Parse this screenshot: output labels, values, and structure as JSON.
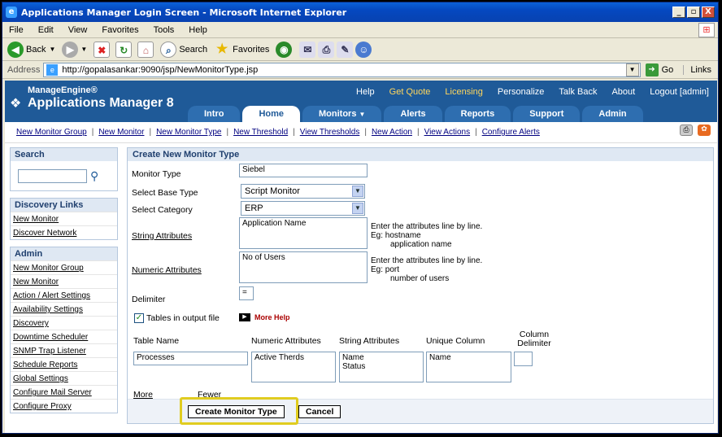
{
  "window": {
    "title": "Applications Manager Login Screen - Microsoft Internet Explorer",
    "btn_min": "_",
    "btn_max": "ฅ",
    "btn_close": "X"
  },
  "menu": [
    "File",
    "Edit",
    "View",
    "Favorites",
    "Tools",
    "Help"
  ],
  "toolbar": {
    "back": "Back",
    "search": "Search",
    "favorites": "Favorites"
  },
  "address": {
    "label": "Address",
    "url": "http://gopalasankar:9090/jsp/NewMonitorType.jsp",
    "go": "Go",
    "links": "Links"
  },
  "app": {
    "logo_top": "ManageEngine®",
    "logo_main": "Applications Manager 8",
    "top_links": [
      "Help",
      "Get Quote",
      "Licensing",
      "Personalize",
      "Talk Back",
      "About",
      "Logout  [admin]"
    ],
    "tabs": [
      "Intro",
      "Home",
      "Monitors",
      "Alerts",
      "Reports",
      "Support",
      "Admin"
    ]
  },
  "subnav": [
    "New Monitor Group",
    "New Monitor",
    "New Monitor Type",
    "New Threshold",
    "View Thresholds",
    "New Action",
    "View Actions",
    "Configure Alerts"
  ],
  "sidebar": {
    "search_title": "Search",
    "discovery_title": "Discovery Links",
    "discovery_items": [
      "New Monitor",
      "Discover Network"
    ],
    "admin_title": "Admin",
    "admin_items": [
      "New Monitor Group",
      "New Monitor",
      "Action / Alert Settings",
      "Availability Settings",
      "Discovery",
      "Downtime Scheduler",
      "SNMP Trap Listener",
      "Schedule Reports",
      "Global Settings",
      "Configure Mail Server",
      "Configure Proxy"
    ]
  },
  "form": {
    "title": "Create New Monitor Type",
    "monitor_type_label": "Monitor Type",
    "monitor_type_value": "Siebel",
    "base_type_label": "Select Base Type",
    "base_type_value": "Script Monitor",
    "category_label": "Select Category",
    "category_value": "ERP",
    "string_attr_label": "String Attributes",
    "string_attr_value": "Application Name",
    "string_hint": [
      "Enter the attributes line by line.",
      "Eg: hostname",
      "application name"
    ],
    "numeric_attr_label": "Numeric Attributes",
    "numeric_attr_value": "No of Users",
    "numeric_hint": [
      "Enter the attributes line by line.",
      "Eg: port",
      "number of users"
    ],
    "delimiter_label": "Delimiter",
    "delimiter_value": "=",
    "tables_label": "Tables in output file",
    "more_help": "More Help",
    "table_headers": [
      "Table Name",
      "Numeric Attributes",
      "String Attributes",
      "Unique Column",
      "Column Delimiter"
    ],
    "table_row": {
      "name": "Processes",
      "numeric": "Active Therds",
      "string": "Name\nStatus",
      "unique": "Name",
      "delimiter": ""
    },
    "more": "More",
    "fewer": "Fewer",
    "create_button": "Create Monitor Type",
    "cancel_button": "Cancel"
  },
  "colors": {
    "header_blue": "#1f5a98",
    "highlight": "#e0cc20",
    "link_yellow": "#ffd65c"
  }
}
